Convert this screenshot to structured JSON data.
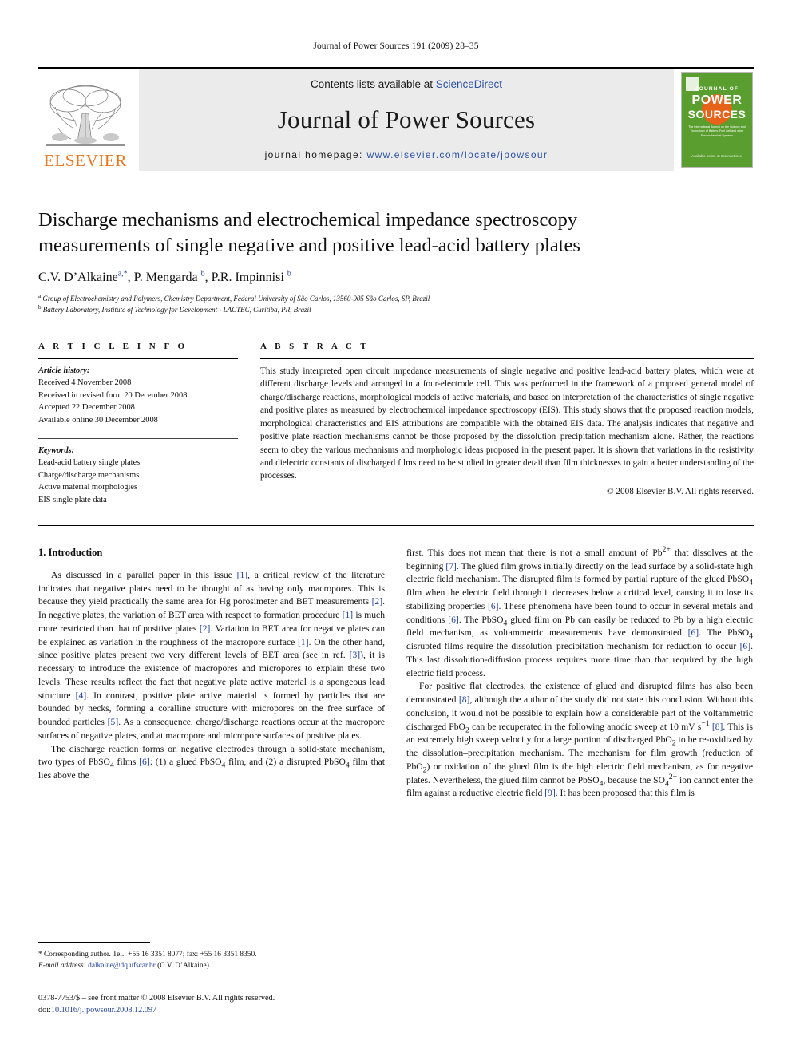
{
  "running_head": "Journal of Power Sources 191 (2009) 28–35",
  "masthead": {
    "publisher_logo_text": "ELSEVIER",
    "contents_prefix": "Contents lists available at ",
    "contents_link": "ScienceDirect",
    "journal_name": "Journal of Power Sources",
    "homepage_prefix": "journal homepage: ",
    "homepage_url": "www.elsevier.com/locate/jpowsour",
    "cover": {
      "line_journal_of": "JOURNAL OF",
      "line_power": "POWER",
      "line_sources": "SOURCES",
      "subtitle": "The International Journal on the Science and Technology of Battery, Fuel Cell and other Electrochemical Systems",
      "science_direct": "Available online at ScienceDirect",
      "green": "#5a9e2f",
      "orange": "#e8631a"
    }
  },
  "article": {
    "title": "Discharge mechanisms and electrochemical impedance spectroscopy measurements of single negative and positive lead-acid battery plates",
    "authors_html": "C.V. D’Alkaine<sup class=\"aff\">a</sup><sup class=\"star\">,*</sup>, P. Mengarda <sup class=\"aff\">b</sup>, P.R. Impinnisi <sup class=\"aff\">b</sup>",
    "affiliation_a": "Group of Electrochemistry and Polymers, Chemistry Department, Federal University of São Carlos, 13560-905 São Carlos, SP, Brazil",
    "affiliation_b": "Battery Laboratory, Institute of Technology for Development - LACTEC, Curitiba, PR, Brazil"
  },
  "article_info": {
    "heading": "A R T I C L E    I N F O",
    "history_label": "Article history:",
    "history": [
      "Received 4 November 2008",
      "Received in revised form 20 December 2008",
      "Accepted 22 December 2008",
      "Available online 30 December 2008"
    ],
    "keywords_label": "Keywords:",
    "keywords": [
      "Lead-acid battery single plates",
      "Charge/discharge mechanisms",
      "Active material morphologies",
      "EIS single plate data"
    ]
  },
  "abstract": {
    "heading": "A B S T R A C T",
    "text": "This study interpreted open circuit impedance measurements of single negative and positive lead-acid battery plates, which were at different discharge levels and arranged in a four-electrode cell. This was performed in the framework of a proposed general model of charge/discharge reactions, morphological models of active materials, and based on interpretation of the characteristics of single negative and positive plates as measured by electrochemical impedance spectroscopy (EIS). This study shows that the proposed reaction models, morphological characteristics and EIS attributions are compatible with the obtained EIS data. The analysis indicates that negative and positive plate reaction mechanisms cannot be those proposed by the dissolution–precipitation mechanism alone. Rather, the reactions seem to obey the various mechanisms and morphologic ideas proposed in the present paper. It is shown that variations in the resistivity and dielectric constants of discharged films need to be studied in greater detail than film thicknesses to gain a better understanding of the processes.",
    "copyright": "© 2008 Elsevier B.V. All rights reserved."
  },
  "body": {
    "section_number_title": "1.  Introduction",
    "left_paragraphs_html": [
      "As discussed in a parallel paper in this issue <span class=\"ref\">[1]</span>, a critical review of the literature indicates that negative plates need to be thought of as having only macropores. This is because they yield practically the same area for Hg porosimeter and BET measurements <span class=\"ref\">[2]</span>. In negative plates, the variation of BET area with respect to formation procedure <span class=\"ref\">[1]</span> is much more restricted than that of positive plates <span class=\"ref\">[2]</span>. Variation in BET area for negative plates can be explained as variation in the roughness of the macropore surface <span class=\"ref\">[1]</span>. On the other hand, since positive plates present two very different levels of BET area (see in ref. <span class=\"ref\">[3]</span>), it is necessary to introduce the existence of macropores and micropores to explain these two levels. These results reflect the fact that negative plate active material is a spongeous lead structure <span class=\"ref\">[4]</span>. In contrast, positive plate active material is formed by particles that are bounded by necks, forming a coralline structure with micropores on the free surface of bounded particles <span class=\"ref\">[5]</span>. As a consequence, charge/discharge reactions occur at the macropore surfaces of negative plates, and at macropore and micropore surfaces of positive plates.",
      "The discharge reaction forms on negative electrodes through a solid-state mechanism, two types of PbSO<sub>4</sub> films <span class=\"ref\">[6]</span>: (1) a glued PbSO<sub>4</sub> film, and (2) a disrupted PbSO<sub>4</sub> film that lies above the"
    ],
    "right_paragraphs_html": [
      "first. This does not mean that there is not a small amount of Pb<sup>2+</sup> that dissolves at the beginning <span class=\"ref\">[7]</span>. The glued film grows initially directly on the lead surface by a solid-state high electric field mechanism. The disrupted film is formed by partial rupture of the glued PbSO<sub>4</sub> film when the electric field through it decreases below a critical level, causing it to lose its stabilizing properties <span class=\"ref\">[6]</span>. These phenomena have been found to occur in several metals and conditions <span class=\"ref\">[6]</span>. The PbSO<sub>4</sub> glued film on Pb can easily be reduced to Pb by a high electric field mechanism, as voltammetric measurements have demonstrated <span class=\"ref\">[6]</span>. The PbSO<sub>4</sub> disrupted films require the dissolution–precipitation mechanism for reduction to occur <span class=\"ref\">[6]</span>. This last dissolution-diffusion process requires more time than that required by the high electric field process.",
      "For positive flat electrodes, the existence of glued and disrupted films has also been demonstrated <span class=\"ref\">[8]</span>, although the author of the study did not state this conclusion. Without this conclusion, it would not be possible to explain how a considerable part of the voltammetric discharged PbO<sub>2</sub> can be recuperated in the following anodic sweep at 10 mV s<sup>−1</sup> <span class=\"ref\">[8]</span>. This is an extremely high sweep velocity for a large portion of discharged PbO<sub>2</sub> to be re-oxidized by the dissolution–precipitation mechanism. The mechanism for film growth (reduction of PbO<sub>2</sub>) or oxidation of the glued film is the high electric field mechanism, as for negative plates. Nevertheless, the glued film cannot be PbSO<sub>4</sub>, because the SO<sub>4</sub><sup>2−</sup> ion cannot enter the film against a reductive electric field <span class=\"ref\">[9]</span>. It has been proposed that this film is"
    ]
  },
  "footnote": {
    "line1": "*  Corresponding author. Tel.: +55 16 3351 8077; fax: +55 16 3351 8350.",
    "email_label": "E-mail address:",
    "email": "dalkaine@dq.ufscar.br",
    "email_owner": "(C.V. D’Alkaine).",
    "issn_line": "0378-7753/$ – see front matter © 2008 Elsevier B.V. All rights reserved.",
    "doi_label": "doi:",
    "doi": "10.1016/j.jpowsour.2008.12.097"
  }
}
